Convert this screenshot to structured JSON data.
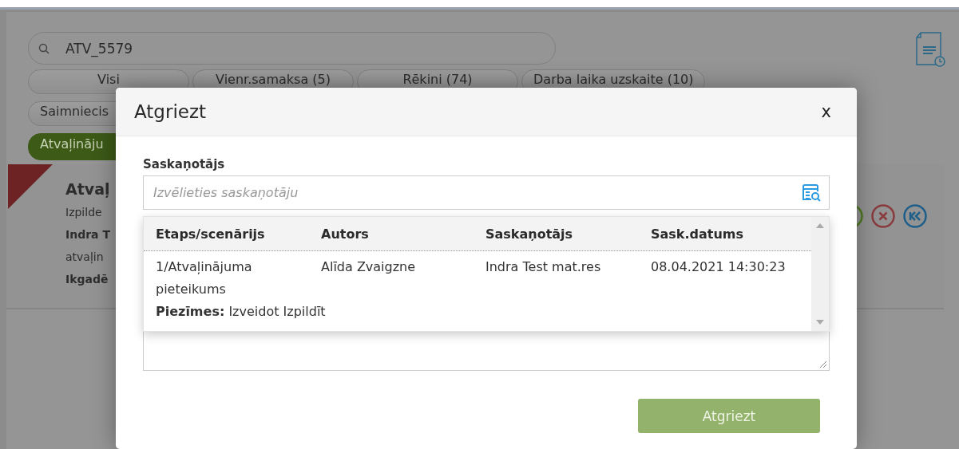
{
  "search": {
    "value": "ATV_5579"
  },
  "filter_rows": [
    [
      {
        "label": "Visi",
        "selected": false
      },
      {
        "label": "Vienr.samaksa (5)",
        "selected": false
      },
      {
        "label": "Rēkini (74)",
        "selected": false
      },
      {
        "label": "Darba laika uzskaite (10)",
        "selected": false
      }
    ],
    [
      {
        "label": "Saimniecis",
        "selected": false
      }
    ],
    [
      {
        "label": "Atvaļināju",
        "selected": true
      }
    ]
  ],
  "card": {
    "title": "Atvaļ",
    "lines": [
      {
        "text": "Izpilde",
        "bold": false
      },
      {
        "text": "Indra T",
        "bold": true
      },
      {
        "text": "atvaļin",
        "bold": false
      },
      {
        "text": "Ikgadē",
        "bold": true
      }
    ]
  },
  "dialog": {
    "title": "Atgriezt",
    "close": "x",
    "field_label": "Saskaņotājs",
    "field": {
      "placeholder": "Izvēlieties saskaņotāju"
    },
    "table": {
      "columns": [
        "Etaps/scenārijs",
        "Autors",
        "Saskaņotājs",
        "Sask.datums"
      ],
      "rows": [
        {
          "cells": [
            "1/Atvaļinājuma pieteikums",
            "Alīda Zvaigzne",
            "Indra Test mat.res",
            "08.04.2021 14:30:23"
          ],
          "note": "**Piezīmes:** Izveidot Izpildīt"
        }
      ]
    },
    "button": {
      "label": "Atgriezt",
      "disabled": true
    }
  }
}
